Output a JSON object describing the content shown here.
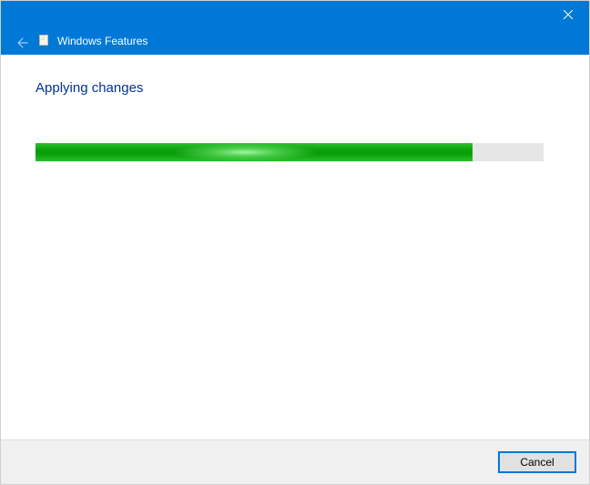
{
  "window": {
    "title": "Windows Features"
  },
  "content": {
    "heading": "Applying changes"
  },
  "progress": {
    "percent": 86,
    "glow_center_percent": 48,
    "fill_color": "#0fa80f",
    "track_color": "#e6e6e6"
  },
  "footer": {
    "cancel_label": "Cancel"
  },
  "icons": {
    "close": "close-icon",
    "back": "back-arrow-icon",
    "features": "windows-features-icon"
  }
}
